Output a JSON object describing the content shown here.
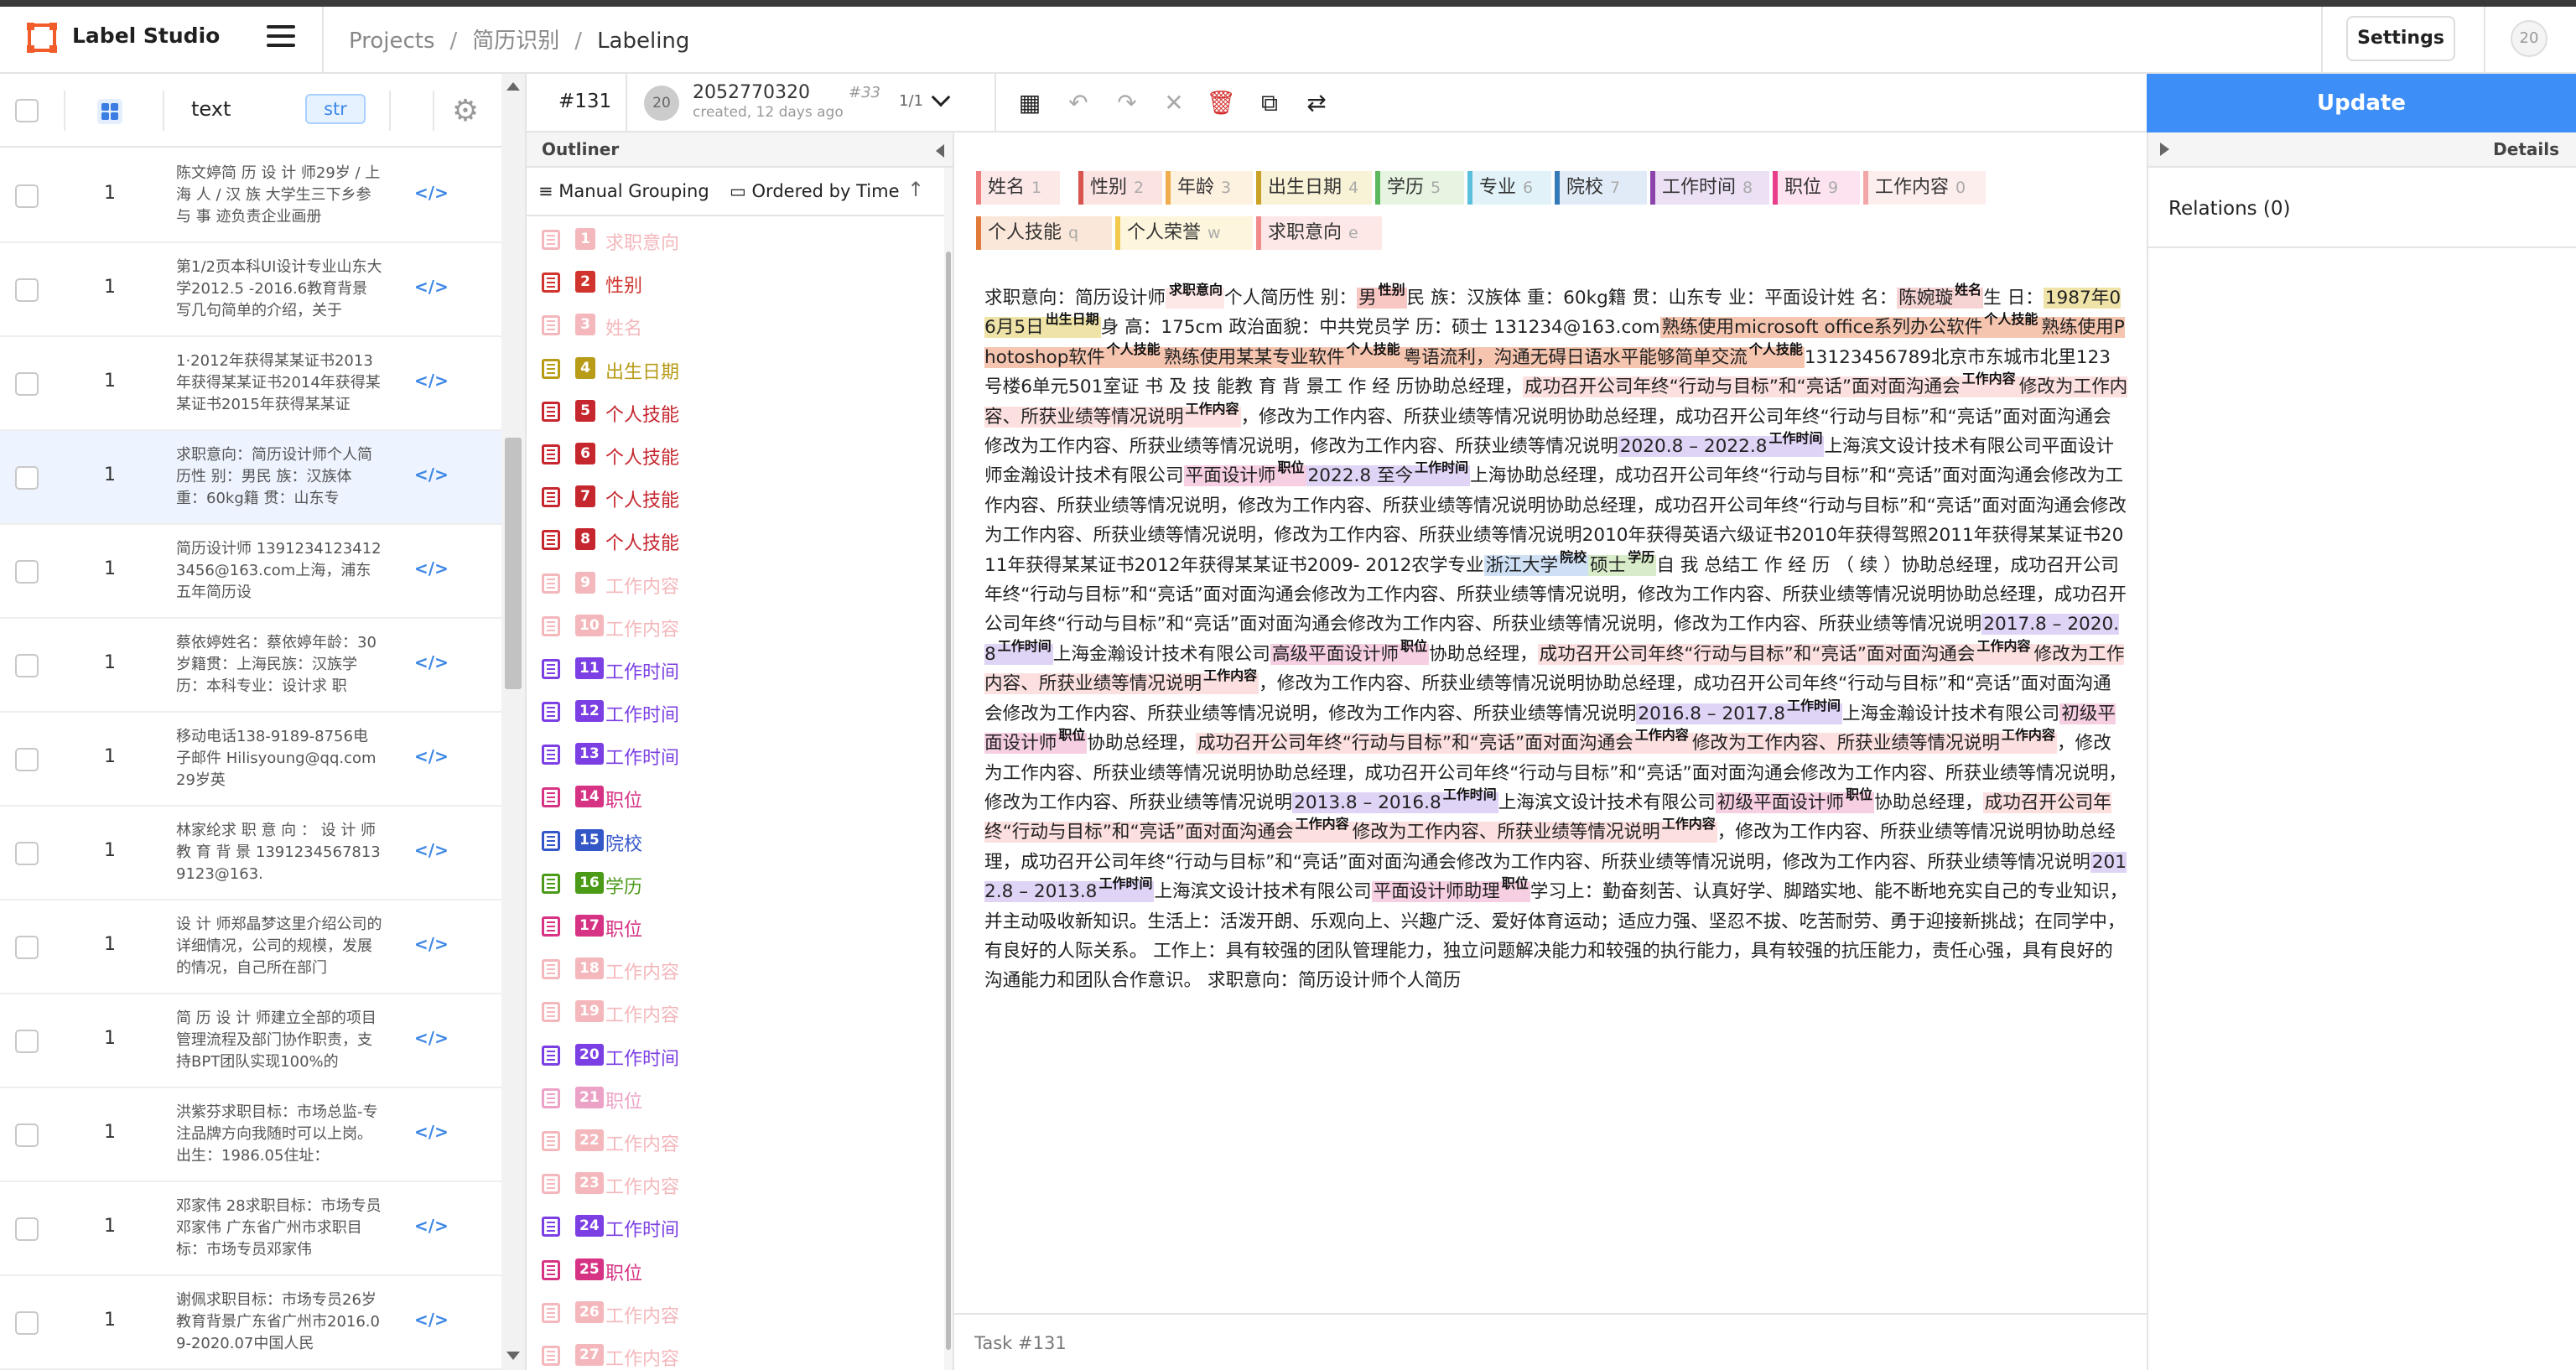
{
  "header": {
    "app_name": "Label Studio",
    "breadcrumb": [
      "Projects",
      "简历识别",
      "Labeling"
    ],
    "settings_label": "Settings",
    "user_initials": "20"
  },
  "tasks_table": {
    "column_text": "text",
    "column_type": "str",
    "rows": [
      {
        "count": "1",
        "text": "陈文婷简 历 设 计 师29岁 / 上 海 人 / 汉 族 大学生三下乡参 与 事 迹负责企业画册",
        "selected": false
      },
      {
        "count": "1",
        "text": "第1/2页本科UI设计专业山东大学2012.5 -2016.6教育背景写几句简单的介绍，关于",
        "selected": false
      },
      {
        "count": "1",
        "text": "1·2012年获得某某证书2013年获得某某证书2014年获得某某证书2015年获得某某证",
        "selected": false
      },
      {
        "count": "1",
        "text": "求职意向：简历设计师个人简历性 别：男民 族：汉族体 重：60kg籍 贯：山东专",
        "selected": true
      },
      {
        "count": "1",
        "text": "简历设计师 1391234123412 3456@163.com上海，浦东五年简历设",
        "selected": false
      },
      {
        "count": "1",
        "text": "蔡依婷姓名：蔡依婷年龄：30岁籍贯：上海民族：汉族学历：本科专业：设计求 职",
        "selected": false
      },
      {
        "count": "1",
        "text": "移动电话138-9189-8756电子邮件 Hilisyoung@qq.com29岁英",
        "selected": false
      },
      {
        "count": "1",
        "text": "林家纶求 职 意 向 ： 设 计 师教 育 背 景 13912345678139123@163.",
        "selected": false
      },
      {
        "count": "1",
        "text": "设 计 师郑晶梦这里介绍公司的详细情况，公司的规模，发展的情况，自己所在部门",
        "selected": false
      },
      {
        "count": "1",
        "text": "简 历 设 计 师建立全部的项目管理流程及部门协作职责，支持BPT团队实现100%的",
        "selected": false
      },
      {
        "count": "1",
        "text": "洪紫芬求职目标：市场总监-专注品牌方向我随时可以上岗。出生：1986.05住址：",
        "selected": false
      },
      {
        "count": "1",
        "text": "邓家伟 28求职目标：市场专员邓家伟 广东省广州市求职目标：市场专员邓家伟",
        "selected": false
      },
      {
        "count": "1",
        "text": "谢佩求职目标：市场专员26岁教育背景广东省广州市2016.09-2020.07中国人民",
        "selected": false
      }
    ]
  },
  "annotation": {
    "task_id": "#131",
    "annotation_id": "2052770320",
    "created": "created, 12 days ago",
    "number": "#33",
    "pagination": "1/1",
    "update_label": "Update"
  },
  "outliner": {
    "title": "Outliner",
    "grouping": "Manual Grouping",
    "ordering": "Ordered by Time",
    "regions": [
      {
        "n": "1",
        "label": "求职意向",
        "color": "#e8616b",
        "faded": true
      },
      {
        "n": "2",
        "label": "性别",
        "color": "#d0342c",
        "faded": false
      },
      {
        "n": "3",
        "label": "姓名",
        "color": "#e8616b",
        "faded": true
      },
      {
        "n": "4",
        "label": "出生日期",
        "color": "#b89b17",
        "faded": false
      },
      {
        "n": "5",
        "label": "个人技能",
        "color": "#c6262e",
        "faded": false
      },
      {
        "n": "6",
        "label": "个人技能",
        "color": "#c6262e",
        "faded": false
      },
      {
        "n": "7",
        "label": "个人技能",
        "color": "#c6262e",
        "faded": false
      },
      {
        "n": "8",
        "label": "个人技能",
        "color": "#c6262e",
        "faded": false
      },
      {
        "n": "9",
        "label": "工作内容",
        "color": "#e8616b",
        "faded": true
      },
      {
        "n": "10",
        "label": "工作内容",
        "color": "#e8616b",
        "faded": true
      },
      {
        "n": "11",
        "label": "工作时间",
        "color": "#7b3fe4",
        "faded": false
      },
      {
        "n": "12",
        "label": "工作时间",
        "color": "#7b3fe4",
        "faded": false
      },
      {
        "n": "13",
        "label": "工作时间",
        "color": "#7b3fe4",
        "faded": false
      },
      {
        "n": "14",
        "label": "职位",
        "color": "#d63384",
        "faded": false
      },
      {
        "n": "15",
        "label": "院校",
        "color": "#3457c8",
        "faded": false
      },
      {
        "n": "16",
        "label": "学历",
        "color": "#4b9a18",
        "faded": false
      },
      {
        "n": "17",
        "label": "职位",
        "color": "#d63384",
        "faded": false
      },
      {
        "n": "18",
        "label": "工作内容",
        "color": "#e8616b",
        "faded": true
      },
      {
        "n": "19",
        "label": "工作内容",
        "color": "#e8616b",
        "faded": true
      },
      {
        "n": "20",
        "label": "工作时间",
        "color": "#7b3fe4",
        "faded": false
      },
      {
        "n": "21",
        "label": "职位",
        "color": "#d63384",
        "faded": true
      },
      {
        "n": "22",
        "label": "工作内容",
        "color": "#e8616b",
        "faded": true
      },
      {
        "n": "23",
        "label": "工作内容",
        "color": "#e8616b",
        "faded": true
      },
      {
        "n": "24",
        "label": "工作时间",
        "color": "#7b3fe4",
        "faded": false
      },
      {
        "n": "25",
        "label": "职位",
        "color": "#d63384",
        "faded": false
      },
      {
        "n": "26",
        "label": "工作内容",
        "color": "#e8616b",
        "faded": true
      },
      {
        "n": "27",
        "label": "工作内容",
        "color": "#e8616b",
        "faded": true
      }
    ]
  },
  "labels": [
    [
      {
        "name": "姓名",
        "key": "1",
        "color": "#f08080",
        "bg": "#fde8e8"
      },
      {
        "name": "性别",
        "key": "2",
        "color": "#d9534f",
        "bg": "#fbe3e2"
      },
      {
        "name": "年龄",
        "key": "3",
        "color": "#f0ad4e",
        "bg": "#fdf1e0"
      },
      {
        "name": "出生日期",
        "key": "4",
        "color": "#c9a227",
        "bg": "#f8f2d6"
      },
      {
        "name": "学历",
        "key": "5",
        "color": "#5cb85c",
        "bg": "#e6f4e1"
      },
      {
        "name": "专业",
        "key": "6",
        "color": "#5bc0de",
        "bg": "#e1f3f8"
      },
      {
        "name": "院校",
        "key": "7",
        "color": "#337ab7",
        "bg": "#e1ebf7"
      },
      {
        "name": "工作时间",
        "key": "8",
        "color": "#8e44ad",
        "bg": "#ece0f5"
      },
      {
        "name": "职位",
        "key": "9",
        "color": "#e83e8c",
        "bg": "#fce3ef"
      },
      {
        "name": "工作内容",
        "key": "0",
        "color": "#f4a6a6",
        "bg": "#fdeeee"
      }
    ],
    [
      {
        "name": "个人技能",
        "key": "q",
        "color": "#e07b39",
        "bg": "#fbe7d9"
      },
      {
        "name": "个人荣誉",
        "key": "w",
        "color": "#f2c94c",
        "bg": "#fdf6dd"
      },
      {
        "name": "求职意向",
        "key": "e",
        "color": "#f28b8b",
        "bg": "#fde7e7"
      }
    ]
  ],
  "document": {
    "segments": [
      {
        "t": "求职意向：简历设计师"
      },
      {
        "t": "",
        "l": "求职意向",
        "bg": "#fde7e7"
      },
      {
        "t": "个人简历性 别："
      },
      {
        "t": "男",
        "l": "性别",
        "bg": "#f8c7c4"
      },
      {
        "t": "民 族：汉族体 重：60kg籍 贯：山东专 业：平面设计姓 名："
      },
      {
        "t": "陈婉璇",
        "l": "姓名",
        "bg": "#f7d4d4"
      },
      {
        "t": "生 日："
      },
      {
        "t": "1987年06月5日",
        "l": "出生日期",
        "bg": "#efe3a8"
      },
      {
        "t": "身 高：175cm 政治面貌：中共党员学 历：硕士 131234@163.com"
      },
      {
        "t": "熟练使用microsoft office系列办公软件",
        "l": "个人技能",
        "bg": "#f6c5b0"
      },
      {
        "t": "熟练使用Photoshop软件",
        "l": "个人技能",
        "bg": "#f6c5b0"
      },
      {
        "t": "熟练使用某某专业软件",
        "l": "个人技能",
        "bg": "#f6c5b0"
      },
      {
        "t": "粤语流利，沟通无碍日语水平能够简单交流",
        "l": "个人技能",
        "bg": "#f6c5b0"
      },
      {
        "t": "13123456789北京市东城市北里123号楼6单元501室证 书 及 技 能教 育 背 景工 作 经 历协助总经理，"
      },
      {
        "t": "成功召开公司年终“行动与目标”和“亮话”面对面沟通会",
        "l": "工作内容",
        "bg": "#fce0e0"
      },
      {
        "t": "修改为工作内容、所获业绩等情况说明",
        "l": "工作内容",
        "bg": "#fce0e0"
      },
      {
        "t": "，修改为工作内容、所获业绩等情况说明协助总经理，成功召开公司年终“行动与目标”和“亮话”面对面沟通会修改为工作内容、所获业绩等情况说明，修改为工作内容、所获业绩等情况说明"
      },
      {
        "t": "2020.8 – 2022.8",
        "l": "工作时间",
        "bg": "#e0d4f6"
      },
      {
        "t": "上海滨文设计技术有限公司平面设计师金瀚设计技术有限公司"
      },
      {
        "t": "平面设计师",
        "l": "职位",
        "bg": "#f6cfe2"
      },
      {
        "t": "2022.8 至今",
        "l": "工作时间",
        "bg": "#e0d4f6"
      },
      {
        "t": "上海协助总经理，成功召开公司年终“行动与目标”和“亮话”面对面沟通会修改为工作内容、所获业绩等情况说明，修改为工作内容、所获业绩等情况说明协助总经理，成功召开公司年终“行动与目标”和“亮话”面对面沟通会修改为工作内容、所获业绩等情况说明，修改为工作内容、所获业绩等情况说明2010年获得英语六级证书2010年获得驾照2011年获得某某证书2011年获得某某证书2012年获得某某证书2009- 2012农学专业"
      },
      {
        "t": "浙江大学",
        "l": "院校",
        "bg": "#cfe0f5"
      },
      {
        "t": "硕士",
        "l": "学历",
        "bg": "#d9ecc9"
      },
      {
        "t": "自 我 总结工 作 经 历 （ 续 ）协助总经理，成功召开公司年终“行动与目标”和“亮话”面对面沟通会修改为工作内容、所获业绩等情况说明，修改为工作内容、所获业绩等情况说明协助总经理，成功召开公司年终“行动与目标”和“亮话”面对面沟通会修改为工作内容、所获业绩等情况说明，修改为工作内容、所获业绩等情况说明"
      },
      {
        "t": "2017.8 – 2020.8",
        "l": "工作时间",
        "bg": "#e0d4f6"
      },
      {
        "t": "上海金瀚设计技术有限公司"
      },
      {
        "t": "高级平面设计师",
        "l": "职位",
        "bg": "#f6cfe2"
      },
      {
        "t": "协助总经理，"
      },
      {
        "t": "成功召开公司年终“行动与目标”和“亮话”面对面沟通会",
        "l": "工作内容",
        "bg": "#fce0e0"
      },
      {
        "t": "修改为工作内容、所获业绩等情况说明",
        "l": "工作内容",
        "bg": "#fce0e0"
      },
      {
        "t": "，修改为工作内容、所获业绩等情况说明协助总经理，成功召开公司年终“行动与目标”和“亮话”面对面沟通会修改为工作内容、所获业绩等情况说明，修改为工作内容、所获业绩等情况说明"
      },
      {
        "t": "2016.8 – 2017.8",
        "l": "工作时间",
        "bg": "#e0d4f6"
      },
      {
        "t": "上海金瀚设计技术有限公司"
      },
      {
        "t": "初级平面设计师",
        "l": "职位",
        "bg": "#f6cfe2"
      },
      {
        "t": "协助总经理，"
      },
      {
        "t": "成功召开公司年终“行动与目标”和“亮话”面对面沟通会",
        "l": "工作内容",
        "bg": "#fce0e0"
      },
      {
        "t": "修改为工作内容、所获业绩等情况说明",
        "l": "工作内容",
        "bg": "#fce0e0"
      },
      {
        "t": "，修改为工作内容、所获业绩等情况说明协助总经理，成功召开公司年终“行动与目标”和“亮话”面对面沟通会修改为工作内容、所获业绩等情况说明，修改为工作内容、所获业绩等情况说明"
      },
      {
        "t": "2013.8 – 2016.8",
        "l": "工作时间",
        "bg": "#e0d4f6"
      },
      {
        "t": "上海滨文设计技术有限公司"
      },
      {
        "t": "初级平面设计师",
        "l": "职位",
        "bg": "#f6cfe2"
      },
      {
        "t": "协助总经理，"
      },
      {
        "t": "成功召开公司年终“行动与目标”和“亮话”面对面沟通会",
        "l": "工作内容",
        "bg": "#fce0e0"
      },
      {
        "t": "修改为工作内容、所获业绩等情况说明",
        "l": "工作内容",
        "bg": "#fce0e0"
      },
      {
        "t": "，修改为工作内容、所获业绩等情况说明协助总经理，成功召开公司年终“行动与目标”和“亮话”面对面沟通会修改为工作内容、所获业绩等情况说明，修改为工作内容、所获业绩等情况说明"
      },
      {
        "t": "2012.8 – 2013.8",
        "l": "工作时间",
        "bg": "#e0d4f6"
      },
      {
        "t": "上海滨文设计技术有限公司"
      },
      {
        "t": "平面设计师助理",
        "l": "职位",
        "bg": "#f6cfe2"
      },
      {
        "t": "学习上：勤奋刻苦、认真好学、脚踏实地、能不断地充实自己的专业知识，并主动吸收新知识。生活上：活泼开朗、乐观向上、兴趣广泛、爱好体育运动；适应力强、坚忍不拔、吃苦耐劳、勇于迎接新挑战；在同学中，有良好的人际关系。 工作上：具有较强的团队管理能力，独立问题解决能力和较强的执行能力，具有较强的抗压能力，责任心强，具有良好的沟通能力和团队合作意识。 求职意向：简历设计师个人简历"
      }
    ]
  },
  "task_footer": "Task #131",
  "details": {
    "title": "Details",
    "relations": "Relations (0)"
  }
}
